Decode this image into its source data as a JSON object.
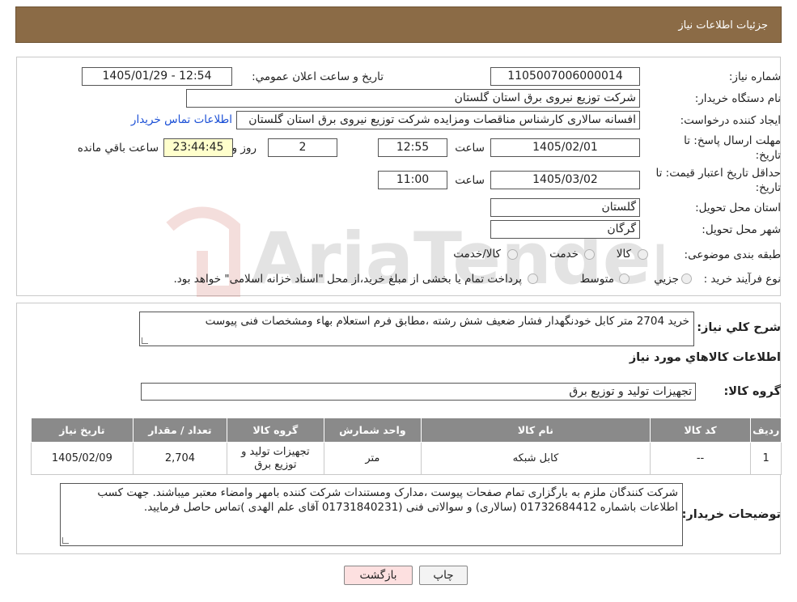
{
  "header": {
    "title": "جزئیات اطلاعات نیاز"
  },
  "fields": {
    "need_number_label": "شماره نیاز:",
    "need_number": "1105007006000014",
    "announce_label": "تاریخ و ساعت اعلان عمومي:",
    "announce_value": "1405/01/29 - 12:54",
    "buyer_org_label": "نام دستگاه خریدار:",
    "buyer_org": "شرکت توزیع نیروی برق استان گلستان",
    "creator_label": "ایجاد کننده درخواست:",
    "creator": "افسانه سالاری کارشناس مناقصات ومزایده شرکت توزیع نیروی برق استان گلستان",
    "contact_link": "اطلاعات تماس خریدار",
    "deadline_label_1": "مهلت ارسال پاسخ: تا",
    "deadline_label_2": "تاریخ:",
    "deadline_date": "1405/02/01",
    "time_label": "ساعت",
    "deadline_time": "12:55",
    "days_value": "2",
    "days_label": "روز و",
    "remaining_time": "23:44:45",
    "remaining_label": "ساعت باقي مانده",
    "validity_label_1": "حداقل تاریخ اعتبار قیمت: تا",
    "validity_label_2": "تاریخ:",
    "validity_date": "1405/03/02",
    "validity_time": "11:00",
    "province_label": "استان محل تحویل:",
    "province": "گلستان",
    "city_label": "شهر محل تحویل:",
    "city": "گرگان",
    "category_label": "طبقه بندی موضوعی:",
    "category_options": [
      "کالا",
      "خدمت",
      "کالا/خدمت"
    ],
    "process_label": "نوع فرآیند خرید :",
    "process_options": [
      "جزیي",
      "متوسط"
    ],
    "process_note": "پرداخت تمام یا بخشی از مبلغ خرید،از محل \"اسناد خزانه اسلامی\" خواهد بود."
  },
  "description": {
    "label": "شرح کلي نیاز:",
    "text": "خرید 2704 متر کابل خودنگهدار فشار ضعیف شش رشته    ،مطابق فرم استعلام بهاء ومشخصات فنی پیوست"
  },
  "goods": {
    "section_title": "اطلاعات کالاهاي مورد نیاز",
    "group_label": "گروه کالا:",
    "group_value": "تجهیزات تولید و توزیع برق",
    "columns": [
      "ردیف",
      "کد کالا",
      "نام کالا",
      "واحد شمارش",
      "گروه کالا",
      "تعداد / مقدار",
      "تاریخ نیاز"
    ],
    "rows": [
      {
        "row": "1",
        "code": "--",
        "name": "کابل شبکه",
        "unit": "متر",
        "group": "تجهیزات تولید و توزیع برق",
        "qty": "2,704",
        "date": "1405/02/09"
      }
    ]
  },
  "buyer_notes": {
    "label": "توضیحات خریدار:",
    "text": "شرکت کنندگان ملزم به بارگزاری تمام صفحات پیوست ،مدارک ومستندات شرکت کننده بامهر وامضاء معتبر میباشند. جهت کسب اطلاعات باشماره 01732684412 (سالاری) و سوالاتی فنی (01731840231 آقای علم الهدی )تماس حاصل فرمایید."
  },
  "buttons": {
    "print": "چاپ",
    "back": "بازگشت"
  },
  "watermark": {
    "text": "AriaTender.neT"
  }
}
